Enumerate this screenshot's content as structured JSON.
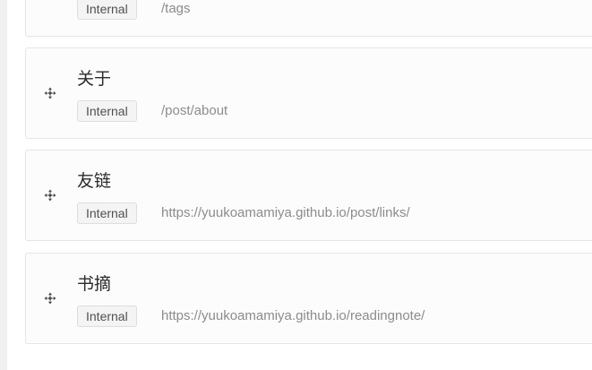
{
  "nav_items": [
    {
      "title": "",
      "type_label": "Internal",
      "url": "/tags",
      "handle_icon": "drag-move-icon"
    },
    {
      "title": "关于",
      "type_label": "Internal",
      "url": "/post/about",
      "handle_icon": "drag-move-icon"
    },
    {
      "title": "友链",
      "type_label": "Internal",
      "url": "https://yuukoamamiya.github.io/post/links/",
      "handle_icon": "drag-move-icon"
    },
    {
      "title": "书摘",
      "type_label": "Internal",
      "url": "https://yuukoamamiya.github.io/readingnote/",
      "handle_icon": "drag-move-icon"
    }
  ],
  "colors": {
    "card_border": "#e6e6e6",
    "card_background": "#fcfcfc",
    "badge_background": "#f4f4f4",
    "url_text": "#8c8c8c"
  }
}
